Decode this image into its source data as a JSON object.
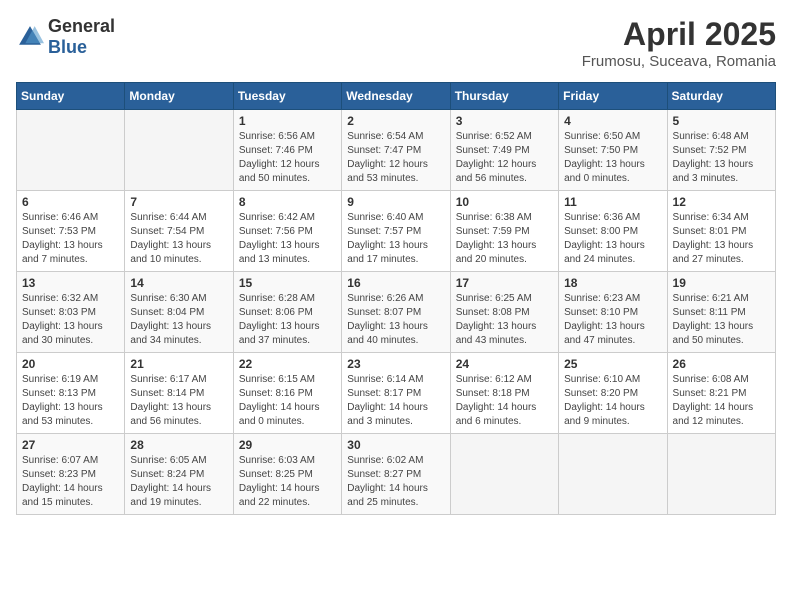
{
  "header": {
    "logo_general": "General",
    "logo_blue": "Blue",
    "title": "April 2025",
    "subtitle": "Frumosu, Suceava, Romania"
  },
  "days_of_week": [
    "Sunday",
    "Monday",
    "Tuesday",
    "Wednesday",
    "Thursday",
    "Friday",
    "Saturday"
  ],
  "weeks": [
    [
      {
        "day": "",
        "info": ""
      },
      {
        "day": "",
        "info": ""
      },
      {
        "day": "1",
        "info": "Sunrise: 6:56 AM\nSunset: 7:46 PM\nDaylight: 12 hours and 50 minutes."
      },
      {
        "day": "2",
        "info": "Sunrise: 6:54 AM\nSunset: 7:47 PM\nDaylight: 12 hours and 53 minutes."
      },
      {
        "day": "3",
        "info": "Sunrise: 6:52 AM\nSunset: 7:49 PM\nDaylight: 12 hours and 56 minutes."
      },
      {
        "day": "4",
        "info": "Sunrise: 6:50 AM\nSunset: 7:50 PM\nDaylight: 13 hours and 0 minutes."
      },
      {
        "day": "5",
        "info": "Sunrise: 6:48 AM\nSunset: 7:52 PM\nDaylight: 13 hours and 3 minutes."
      }
    ],
    [
      {
        "day": "6",
        "info": "Sunrise: 6:46 AM\nSunset: 7:53 PM\nDaylight: 13 hours and 7 minutes."
      },
      {
        "day": "7",
        "info": "Sunrise: 6:44 AM\nSunset: 7:54 PM\nDaylight: 13 hours and 10 minutes."
      },
      {
        "day": "8",
        "info": "Sunrise: 6:42 AM\nSunset: 7:56 PM\nDaylight: 13 hours and 13 minutes."
      },
      {
        "day": "9",
        "info": "Sunrise: 6:40 AM\nSunset: 7:57 PM\nDaylight: 13 hours and 17 minutes."
      },
      {
        "day": "10",
        "info": "Sunrise: 6:38 AM\nSunset: 7:59 PM\nDaylight: 13 hours and 20 minutes."
      },
      {
        "day": "11",
        "info": "Sunrise: 6:36 AM\nSunset: 8:00 PM\nDaylight: 13 hours and 24 minutes."
      },
      {
        "day": "12",
        "info": "Sunrise: 6:34 AM\nSunset: 8:01 PM\nDaylight: 13 hours and 27 minutes."
      }
    ],
    [
      {
        "day": "13",
        "info": "Sunrise: 6:32 AM\nSunset: 8:03 PM\nDaylight: 13 hours and 30 minutes."
      },
      {
        "day": "14",
        "info": "Sunrise: 6:30 AM\nSunset: 8:04 PM\nDaylight: 13 hours and 34 minutes."
      },
      {
        "day": "15",
        "info": "Sunrise: 6:28 AM\nSunset: 8:06 PM\nDaylight: 13 hours and 37 minutes."
      },
      {
        "day": "16",
        "info": "Sunrise: 6:26 AM\nSunset: 8:07 PM\nDaylight: 13 hours and 40 minutes."
      },
      {
        "day": "17",
        "info": "Sunrise: 6:25 AM\nSunset: 8:08 PM\nDaylight: 13 hours and 43 minutes."
      },
      {
        "day": "18",
        "info": "Sunrise: 6:23 AM\nSunset: 8:10 PM\nDaylight: 13 hours and 47 minutes."
      },
      {
        "day": "19",
        "info": "Sunrise: 6:21 AM\nSunset: 8:11 PM\nDaylight: 13 hours and 50 minutes."
      }
    ],
    [
      {
        "day": "20",
        "info": "Sunrise: 6:19 AM\nSunset: 8:13 PM\nDaylight: 13 hours and 53 minutes."
      },
      {
        "day": "21",
        "info": "Sunrise: 6:17 AM\nSunset: 8:14 PM\nDaylight: 13 hours and 56 minutes."
      },
      {
        "day": "22",
        "info": "Sunrise: 6:15 AM\nSunset: 8:16 PM\nDaylight: 14 hours and 0 minutes."
      },
      {
        "day": "23",
        "info": "Sunrise: 6:14 AM\nSunset: 8:17 PM\nDaylight: 14 hours and 3 minutes."
      },
      {
        "day": "24",
        "info": "Sunrise: 6:12 AM\nSunset: 8:18 PM\nDaylight: 14 hours and 6 minutes."
      },
      {
        "day": "25",
        "info": "Sunrise: 6:10 AM\nSunset: 8:20 PM\nDaylight: 14 hours and 9 minutes."
      },
      {
        "day": "26",
        "info": "Sunrise: 6:08 AM\nSunset: 8:21 PM\nDaylight: 14 hours and 12 minutes."
      }
    ],
    [
      {
        "day": "27",
        "info": "Sunrise: 6:07 AM\nSunset: 8:23 PM\nDaylight: 14 hours and 15 minutes."
      },
      {
        "day": "28",
        "info": "Sunrise: 6:05 AM\nSunset: 8:24 PM\nDaylight: 14 hours and 19 minutes."
      },
      {
        "day": "29",
        "info": "Sunrise: 6:03 AM\nSunset: 8:25 PM\nDaylight: 14 hours and 22 minutes."
      },
      {
        "day": "30",
        "info": "Sunrise: 6:02 AM\nSunset: 8:27 PM\nDaylight: 14 hours and 25 minutes."
      },
      {
        "day": "",
        "info": ""
      },
      {
        "day": "",
        "info": ""
      },
      {
        "day": "",
        "info": ""
      }
    ]
  ]
}
